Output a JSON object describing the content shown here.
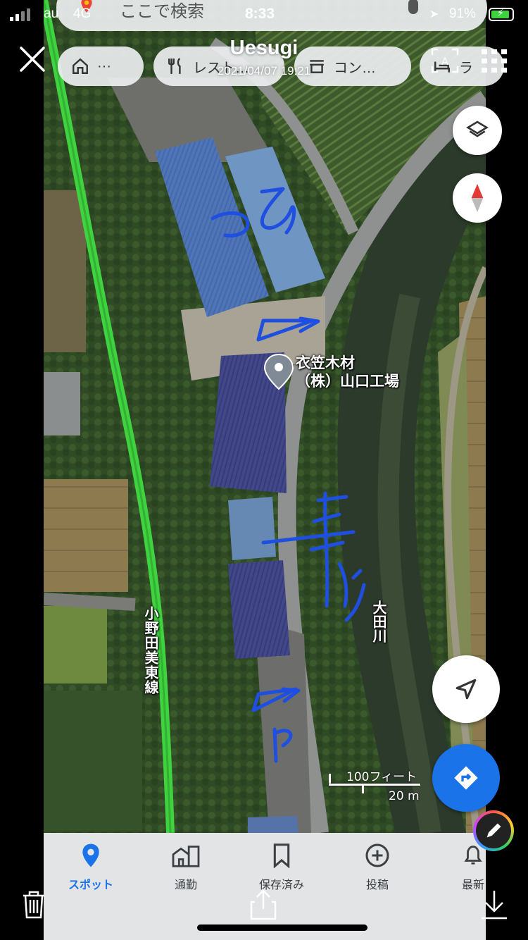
{
  "status_bar": {
    "carrier": "au",
    "network": "4G",
    "time": "8:33",
    "battery_percent": "91%",
    "battery_level": 0.91
  },
  "editor": {
    "title": "Uesugi",
    "date": "2021/04/07 19:21"
  },
  "search": {
    "placeholder": "ここで検索"
  },
  "chips": [
    {
      "label": "···",
      "icon": "home-icon"
    },
    {
      "label": "レスト…",
      "icon": "restaurant-icon"
    },
    {
      "label": "コン…",
      "icon": "store-icon"
    },
    {
      "label": "ラ",
      "icon": "hotel-icon"
    }
  ],
  "map": {
    "place_name_line1": "衣笠木材",
    "place_name_line2": "（株）山口工場",
    "river_label": "大田川",
    "road_label": "小野田美東線",
    "scale_feet": "100フィート",
    "scale_meters": "20 m"
  },
  "handwriting": {
    "warehouse_note": "つみ",
    "road_note": "一車線",
    "parking_note": "P",
    "color": "#1f4fe0"
  },
  "bottom_nav": {
    "tabs": [
      {
        "label": "スポット",
        "icon": "location-pin-icon",
        "active": true
      },
      {
        "label": "通勤",
        "icon": "commute-icon",
        "active": false
      },
      {
        "label": "保存済み",
        "icon": "bookmark-icon",
        "active": false
      },
      {
        "label": "投稿",
        "icon": "add-circle-icon",
        "active": false
      },
      {
        "label": "最新",
        "icon": "bell-icon",
        "active": false
      }
    ]
  },
  "colors": {
    "accent_blue": "#1a73e8",
    "highlight_road": "#3fd43f",
    "battery_green": "#3ed33e"
  }
}
